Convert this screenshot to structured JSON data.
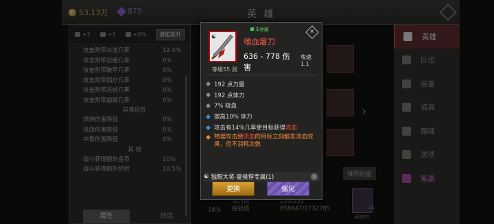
{
  "header": {
    "gold": "53.13万",
    "gems": "875",
    "title": "英 雄"
  },
  "left_panel": {
    "head": {
      "stat1": "+2",
      "stat2": "+3",
      "stat3": "+0%",
      "button": "潜能提升"
    },
    "rows_top": [
      {
        "label": "攻击附带冰冻几率",
        "value": "12.4%"
      },
      {
        "label": "攻击附带迟缓几率",
        "value": "0%"
      },
      {
        "label": "攻击附带破甲几率",
        "value": "0%"
      },
      {
        "label": "攻击附带弱疗几率",
        "value": "0%"
      },
      {
        "label": "攻击附带冻结几率",
        "value": "0%"
      },
      {
        "label": "攻击附带崩解几率",
        "value": "0%"
      }
    ],
    "section1": "异常抗性",
    "rows_mid": [
      {
        "label": "燃烧伤害降低",
        "value": "0%"
      },
      {
        "label": "流血伤害降低",
        "value": "0%"
      },
      {
        "label": "中毒伤害降低",
        "value": "0%"
      }
    ],
    "section2": "其 他",
    "rows_bot": [
      {
        "label": "战斗获得额外金币",
        "value": "10%"
      },
      {
        "label": "战斗获得额外经验",
        "value": "10.5%"
      }
    ],
    "tabs": [
      "属性",
      "技能"
    ]
  },
  "sidebar": {
    "items": [
      "英雄",
      "队伍",
      "装备",
      "道具",
      "魔魂",
      "选项",
      "紫晶"
    ]
  },
  "background": {
    "recommend": "推荐配备",
    "bottom_lines": [
      "流力值",
      "经验值"
    ],
    "bottom_values": [
      "253/253",
      "858647/1732785"
    ],
    "pct": "16%",
    "xp_label": "经验书",
    "xp_count": "31"
  },
  "item": {
    "equipped_tag": "未收藏",
    "name": "嗜血屠刀",
    "damage": "636 - 778 伤害",
    "speed": "攻速 1.1",
    "level": "等级55 剑",
    "stats": [
      "192 点力量",
      "192 点体力",
      "7% 吸血"
    ],
    "bonus1": "提高10% 体力",
    "bonus2_prefix": "攻击有14%几率使目标获得",
    "bonus2_key": "流血",
    "effect_prefix": "物理攻击使",
    "effect_key": "流血",
    "effect_suffix": "的目标立刻触发流血效果，但不消耗次数",
    "set_name": "独眼大将-夏侯惇专属(1)",
    "info_icon": "i",
    "swap_button": "更换",
    "enhance_button": "强化"
  },
  "colors": {
    "item_name": "#ff5a4a",
    "effect": "#ff8a3a",
    "bleed": "#ff4a3a",
    "active_nav": "#5b2d2d"
  }
}
